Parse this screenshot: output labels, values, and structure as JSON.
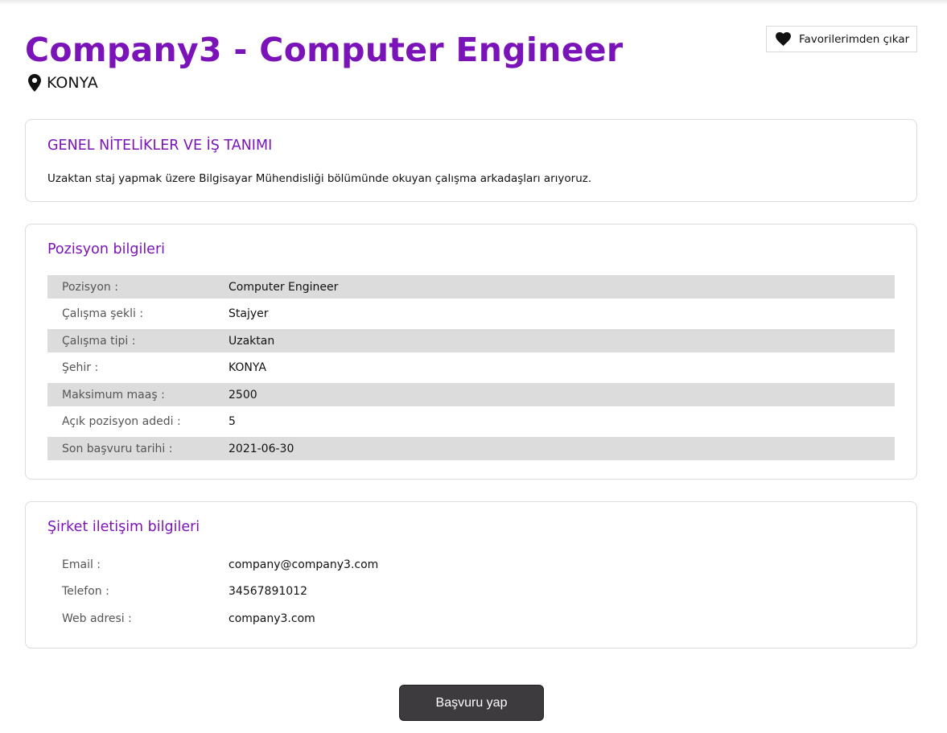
{
  "header": {
    "title": "Company3 - Computer Engineer",
    "location": "KONYA",
    "favorite_button_label": "Favorilerimden çıkar"
  },
  "qualifications": {
    "title": "GENEL NİTELİKLER VE İŞ TANIMI",
    "description": "Uzaktan staj yapmak üzere Bilgisayar Mühendisliği bölümünde okuyan çalışma arkadaşları arıyoruz."
  },
  "position": {
    "title": "Pozisyon bilgileri",
    "rows": [
      {
        "label": "Pozisyon :",
        "value": "Computer Engineer"
      },
      {
        "label": "Çalışma şekli :",
        "value": "Stajyer"
      },
      {
        "label": "Çalışma tipi :",
        "value": "Uzaktan"
      },
      {
        "label": "Şehir :",
        "value": "KONYA"
      },
      {
        "label": "Maksimum maaş :",
        "value": "2500"
      },
      {
        "label": "Açık pozisyon adedi :",
        "value": "5"
      },
      {
        "label": "Son başvuru tarihi :",
        "value": "2021-06-30"
      }
    ]
  },
  "contact": {
    "title": "Şirket iletişim bilgileri",
    "rows": [
      {
        "label": "Email :",
        "value": "company@company3.com"
      },
      {
        "label": "Telefon :",
        "value": "34567891012"
      },
      {
        "label": "Web adresi :",
        "value": "company3.com"
      }
    ]
  },
  "apply_button_label": "Başvuru yap",
  "colors": {
    "accent": "#7b14b8",
    "row_shade": "#dcdcdc",
    "button_dark": "#3d3b3d"
  },
  "icons": {
    "location": "map-pin-icon",
    "favorite": "heart-icon"
  }
}
